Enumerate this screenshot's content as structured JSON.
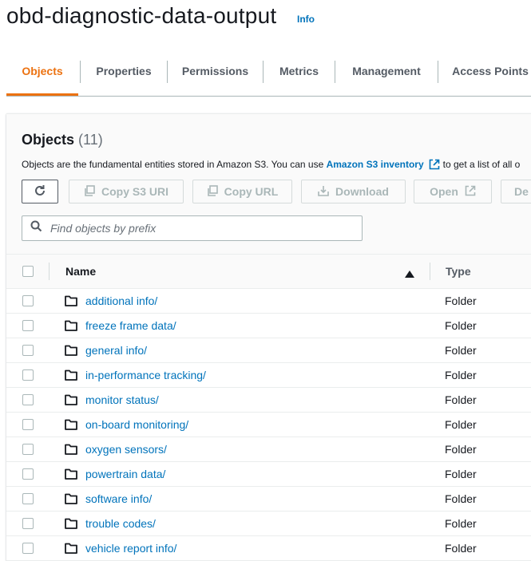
{
  "header": {
    "title": "obd-diagnostic-data-output",
    "info_label": "Info"
  },
  "tabs": [
    {
      "label": "Objects",
      "active": true
    },
    {
      "label": "Properties",
      "active": false
    },
    {
      "label": "Permissions",
      "active": false
    },
    {
      "label": "Metrics",
      "active": false
    },
    {
      "label": "Management",
      "active": false
    },
    {
      "label": "Access Points",
      "active": false
    }
  ],
  "objects": {
    "title": "Objects",
    "count": "(11)",
    "description_prefix": "Objects are the fundamental entities stored in Amazon S3. You can use",
    "description_link": "Amazon S3 inventory",
    "description_suffix": "to get a list of all o",
    "toolbar": {
      "copy_s3_uri": "Copy S3 URI",
      "copy_url": "Copy URL",
      "download": "Download",
      "open": "Open",
      "delete_truncated": "De"
    },
    "search_placeholder": "Find objects by prefix",
    "columns": {
      "name": "Name",
      "type": "Type"
    },
    "rows": [
      {
        "name": "additional info/",
        "type": "Folder"
      },
      {
        "name": "freeze frame data/",
        "type": "Folder"
      },
      {
        "name": "general info/",
        "type": "Folder"
      },
      {
        "name": "in-performance tracking/",
        "type": "Folder"
      },
      {
        "name": "monitor status/",
        "type": "Folder"
      },
      {
        "name": "on-board monitoring/",
        "type": "Folder"
      },
      {
        "name": "oxygen sensors/",
        "type": "Folder"
      },
      {
        "name": "powertrain data/",
        "type": "Folder"
      },
      {
        "name": "software info/",
        "type": "Folder"
      },
      {
        "name": "trouble codes/",
        "type": "Folder"
      },
      {
        "name": "vehicle report info/",
        "type": "Folder"
      }
    ]
  },
  "colors": {
    "accent": "#ec7211",
    "link": "#0073bb",
    "text": "#16191f",
    "muted": "#aab7b8"
  }
}
